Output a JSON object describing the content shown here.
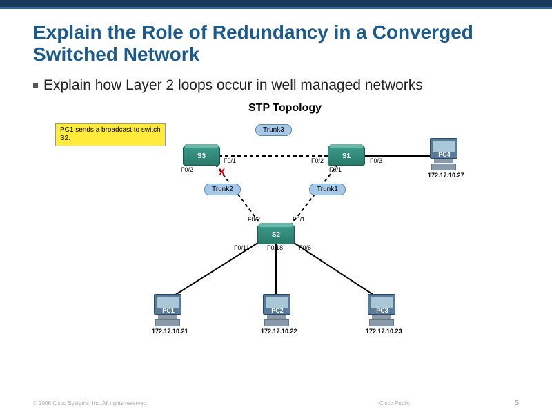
{
  "slide": {
    "title": "Explain the Role of Redundancy in a Converged Switched Network",
    "bullet": "Explain how Layer 2 loops occur in well managed networks"
  },
  "diagram": {
    "title": "STP Topology",
    "callout": "PC1 sends a broadcast to switch S2.",
    "trunks": {
      "t1": "Trunk1",
      "t2": "Trunk2",
      "t3": "Trunk3"
    },
    "switches": {
      "s1": "S1",
      "s2": "S2",
      "s3": "S3"
    },
    "ports": {
      "s3_f02": "F0/2",
      "s3_f01": "F0/1",
      "s1_f02": "F0/2",
      "s1_f01": "F0/1",
      "s1_f03": "F0/3",
      "s2_f02": "F0/2",
      "s2_f01": "F0/1",
      "s2_f011": "F0/11",
      "s2_f018": "F0/18",
      "s2_f06": "F0/6"
    },
    "block_mark": "X",
    "pcs": {
      "pc1": {
        "name": "PC1",
        "ip": "172.17.10.21"
      },
      "pc2": {
        "name": "PC2",
        "ip": "172.17.10.22"
      },
      "pc3": {
        "name": "PC3",
        "ip": "172.17.10.23"
      },
      "pc4": {
        "name": "PC4",
        "ip": "172.17.10.27"
      }
    }
  },
  "footer": {
    "copyright": "© 2006 Cisco Systems, Inc. All rights reserved.",
    "label": "Cisco Public",
    "page": "5"
  }
}
